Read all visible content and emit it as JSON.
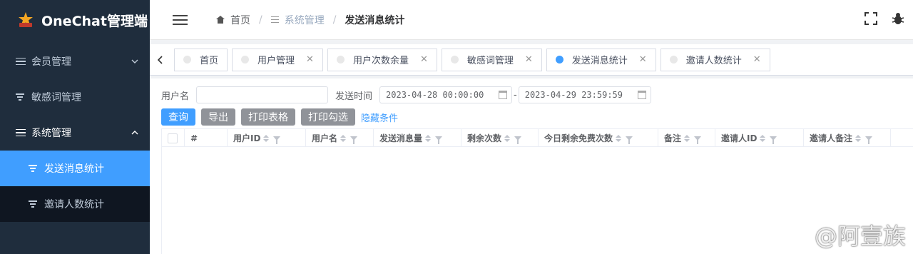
{
  "app": {
    "title": "OneChat管理端"
  },
  "sidebar": {
    "items": [
      {
        "label": "会员管理",
        "expanded": false
      },
      {
        "label": "敏感词管理"
      },
      {
        "label": "系统管理",
        "expanded": true
      },
      {
        "label": "发送消息统计",
        "active": true
      },
      {
        "label": "邀请人数统计"
      }
    ]
  },
  "breadcrumb": {
    "home": "首页",
    "parent": "系统管理",
    "current": "发送消息统计"
  },
  "tags": [
    {
      "label": "首页",
      "closable": false,
      "active": false
    },
    {
      "label": "用户管理",
      "closable": true,
      "active": false
    },
    {
      "label": "用户次数余量",
      "closable": true,
      "active": false
    },
    {
      "label": "敏感词管理",
      "closable": true,
      "active": false
    },
    {
      "label": "发送消息统计",
      "closable": true,
      "active": true
    },
    {
      "label": "邀请人数统计",
      "closable": true,
      "active": false
    }
  ],
  "filter": {
    "username_label": "用户名",
    "username_value": "",
    "time_label": "发送时间",
    "start": "2023-04-28 00:00:00",
    "end": "2023-04-29 23:59:59",
    "range_separator": "-"
  },
  "actions": {
    "query": "查询",
    "export": "导出",
    "print_table": "打印表格",
    "print_selected": "打印勾选",
    "hide": "隐藏条件"
  },
  "table": {
    "columns": [
      "#",
      "用户ID",
      "用户名",
      "发送消息量",
      "剩余次数",
      "今日剩余免费次数",
      "备注",
      "邀请人ID",
      "邀请人备注"
    ],
    "rows": []
  },
  "watermark": "@阿壹族",
  "colors": {
    "sidebar": "#1f2d3d",
    "accent": "#409eff",
    "info": "#909399"
  }
}
